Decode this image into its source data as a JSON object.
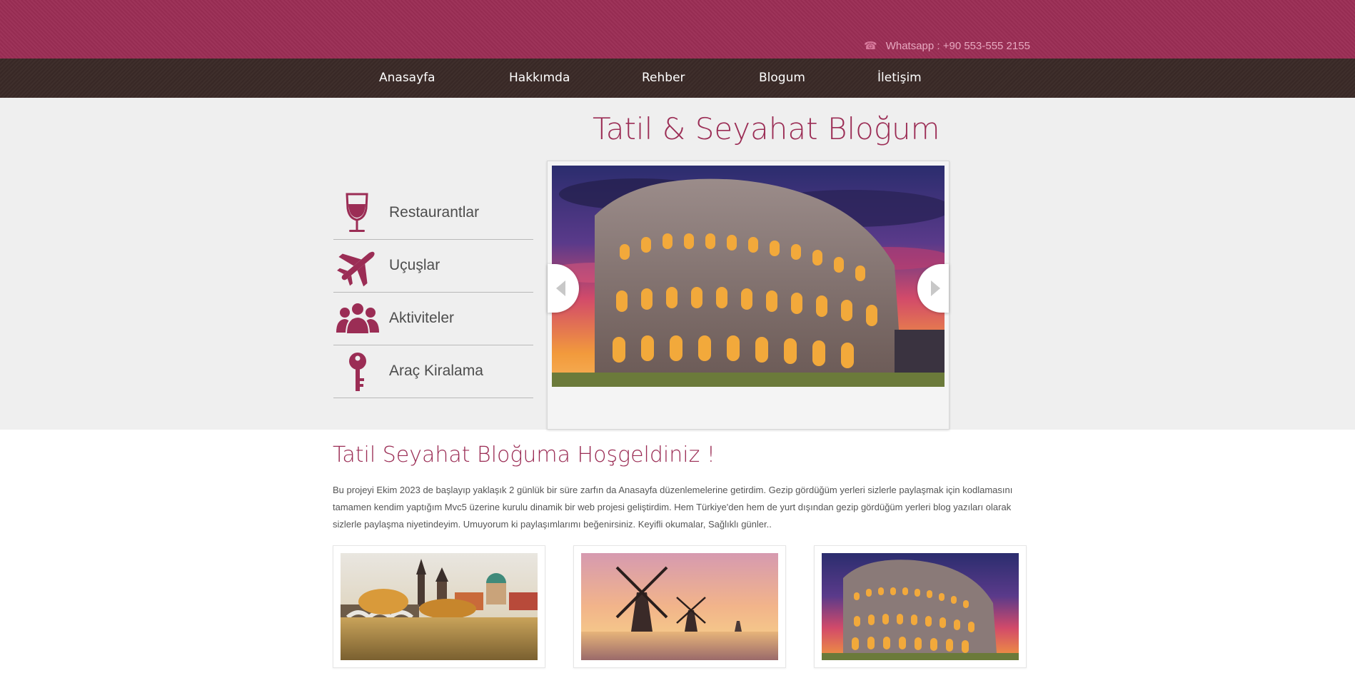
{
  "header": {
    "contact_icon": "phone-icon",
    "contact_text": "Whatsapp : +90 553-555 2155"
  },
  "nav": {
    "items": [
      {
        "label": "Anasayfa"
      },
      {
        "label": "Hakkımda"
      },
      {
        "label": "Rehber"
      },
      {
        "label": "Blogum"
      },
      {
        "label": "İletişim"
      }
    ]
  },
  "hero": {
    "title": "Tatil & Seyahat Bloğum",
    "menu": [
      {
        "label": "Restaurantlar",
        "icon": "wine-glass-icon"
      },
      {
        "label": "Uçuşlar",
        "icon": "airplane-icon"
      },
      {
        "label": "Aktiviteler",
        "icon": "people-icon"
      },
      {
        "label": "Araç Kiralama",
        "icon": "key-icon"
      }
    ],
    "slider": {
      "current_slide": "colosseum-photo"
    }
  },
  "welcome": {
    "title": "Tatil Seyahat Bloğuma Hoşgeldiniz !",
    "text": "Bu projeyi Ekim 2023 de başlayıp yaklaşık 2 günlük bir süre zarfın da Anasayfa düzenlemelerine getirdim. Gezip gördüğüm yerleri sizlerle paylaşmak için kodlamasını tamamen kendim yaptığım Mvc5 üzerine kurulu dinamik bir web projesi geliştirdim. Hem Türkiye'den hem de yurt dışından gezip gördüğüm yerleri blog yazıları olarak sizlerle paylaşma niyetindeyim. Umuyorum ki paylaşımlarımı beğenirsiniz. Keyifli okumalar, Sağlıklı günler.."
  },
  "gallery": {
    "photos": [
      "prague-photo",
      "windmill-photo",
      "colosseum-photo"
    ]
  },
  "colors": {
    "brand": "#9b2d55",
    "nav_bg": "#3a2a27",
    "hero_bg": "#efefef"
  }
}
